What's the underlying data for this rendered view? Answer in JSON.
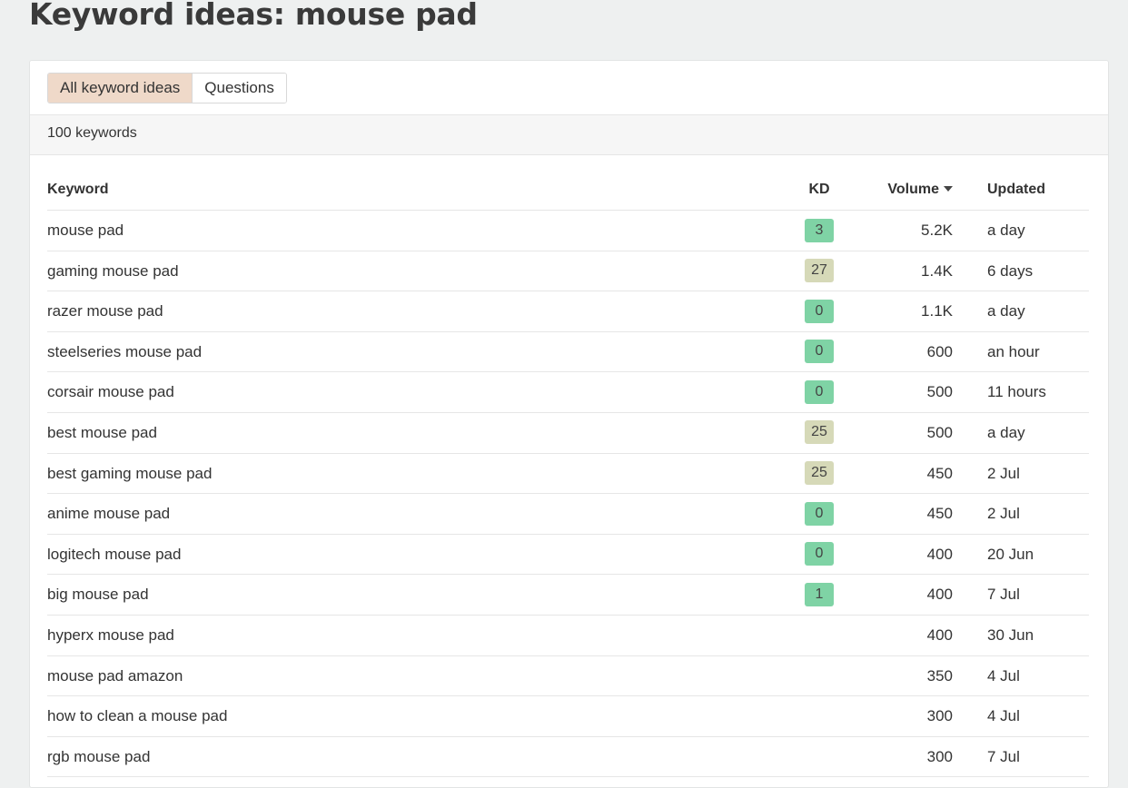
{
  "page": {
    "title": "Keyword ideas: mouse pad"
  },
  "tabs": [
    {
      "label": "All keyword ideas",
      "active": true
    },
    {
      "label": "Questions",
      "active": false
    }
  ],
  "count_label": "100 keywords",
  "colors": {
    "kd_green": "#7fd3a5",
    "kd_tan": "#d6d9b8",
    "tab_active": "#efd9c9"
  },
  "table": {
    "headers": {
      "keyword": "Keyword",
      "kd": "KD",
      "volume": "Volume",
      "updated": "Updated"
    },
    "sort_icon": "caret-down-icon",
    "rows": [
      {
        "keyword": "mouse pad",
        "kd": "3",
        "kd_color": "#7fd3a5",
        "volume": "5.2K",
        "updated": "a day"
      },
      {
        "keyword": "gaming mouse pad",
        "kd": "27",
        "kd_color": "#d6d9b8",
        "volume": "1.4K",
        "updated": "6 days"
      },
      {
        "keyword": "razer mouse pad",
        "kd": "0",
        "kd_color": "#7fd3a5",
        "volume": "1.1K",
        "updated": "a day"
      },
      {
        "keyword": "steelseries mouse pad",
        "kd": "0",
        "kd_color": "#7fd3a5",
        "volume": "600",
        "updated": "an hour"
      },
      {
        "keyword": "corsair mouse pad",
        "kd": "0",
        "kd_color": "#7fd3a5",
        "volume": "500",
        "updated": "11 hours"
      },
      {
        "keyword": "best mouse pad",
        "kd": "25",
        "kd_color": "#d6d9b8",
        "volume": "500",
        "updated": "a day"
      },
      {
        "keyword": "best gaming mouse pad",
        "kd": "25",
        "kd_color": "#d6d9b8",
        "volume": "450",
        "updated": "2 Jul"
      },
      {
        "keyword": "anime mouse pad",
        "kd": "0",
        "kd_color": "#7fd3a5",
        "volume": "450",
        "updated": "2 Jul"
      },
      {
        "keyword": "logitech mouse pad",
        "kd": "0",
        "kd_color": "#7fd3a5",
        "volume": "400",
        "updated": "20 Jun"
      },
      {
        "keyword": "big mouse pad",
        "kd": "1",
        "kd_color": "#7fd3a5",
        "volume": "400",
        "updated": "7 Jul"
      },
      {
        "keyword": "hyperx mouse pad",
        "kd": "",
        "kd_color": "",
        "volume": "400",
        "updated": "30 Jun"
      },
      {
        "keyword": "mouse pad amazon",
        "kd": "",
        "kd_color": "",
        "volume": "350",
        "updated": "4 Jul"
      },
      {
        "keyword": "how to clean a mouse pad",
        "kd": "",
        "kd_color": "",
        "volume": "300",
        "updated": "4 Jul"
      },
      {
        "keyword": "rgb mouse pad",
        "kd": "",
        "kd_color": "",
        "volume": "300",
        "updated": "7 Jul"
      }
    ]
  }
}
